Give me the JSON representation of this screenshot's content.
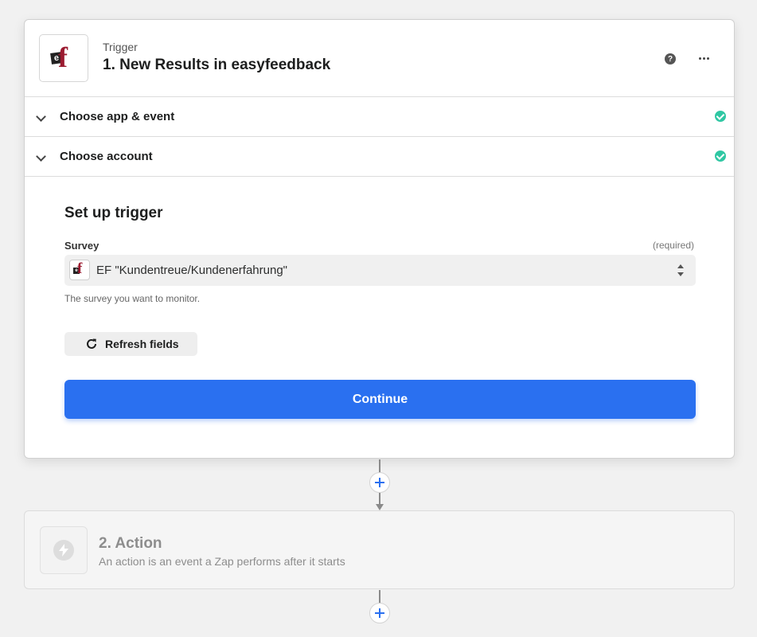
{
  "trigger_step": {
    "label": "Trigger",
    "title": "1. New Results in easyfeedback",
    "app_icon": "easyfeedback-logo",
    "logo_text_e": "e",
    "logo_text_f": "f",
    "help_icon": "question-icon",
    "help_glyph": "?",
    "menu_icon": "more-horizontal-icon"
  },
  "sections": [
    {
      "label": "Choose app & event",
      "status": "complete"
    },
    {
      "label": "Choose account",
      "status": "complete"
    }
  ],
  "setup": {
    "title": "Set up trigger",
    "field": {
      "label": "Survey",
      "required_text": "(required)",
      "value": "EF \"Kundentreue/Kundenerfahrung\"",
      "help_text": "The survey you want to monitor."
    },
    "refresh_label": "Refresh fields",
    "continue_label": "Continue"
  },
  "action_step": {
    "title": "2. Action",
    "description": "An action is an event a Zap performs after it starts",
    "icon": "bolt-icon"
  },
  "colors": {
    "primary": "#2a70f0",
    "success": "#2fc7a3",
    "brand_red": "#9b1b30",
    "background": "#f1f1f1"
  }
}
